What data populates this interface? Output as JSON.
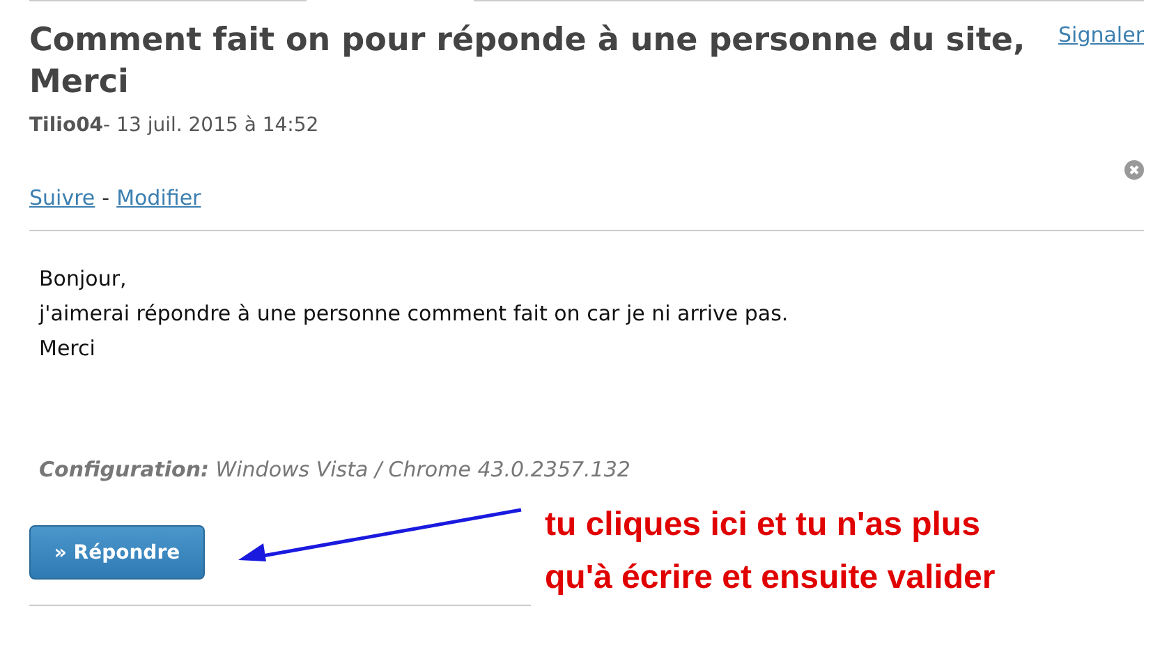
{
  "question": {
    "title": "Comment fait on pour réponde à une personne du site, Merci",
    "report_link": "Signaler",
    "author": "Tilio04",
    "date": "- 13 juil. 2015 à 14:52",
    "actions": [
      {
        "label": "Suivre"
      },
      {
        "label": "Modifier"
      }
    ],
    "action_separator": "-",
    "body": [
      "Bonjour,",
      "j'aimerai répondre à une personne comment fait on car je ni arrive pas.",
      "Merci"
    ],
    "configuration": "**Configuration:** Windows Vista / Chrome 43.0.2357.132",
    "reply_button": "» Répondre"
  },
  "annotation": {
    "lines": [
      "tu cliques ici et tu n'as plus",
      "qu'à écrire et ensuite valider"
    ]
  }
}
